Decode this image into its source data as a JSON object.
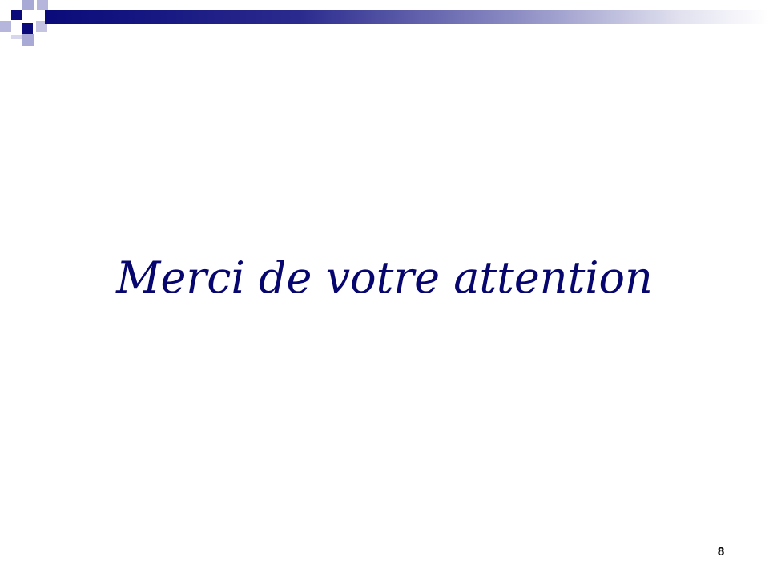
{
  "slide": {
    "title": "Merci de votre attention",
    "page_number": "8"
  },
  "colors": {
    "accent": "#0a0a7a",
    "title_text": "#06066e",
    "background": "#ffffff"
  }
}
